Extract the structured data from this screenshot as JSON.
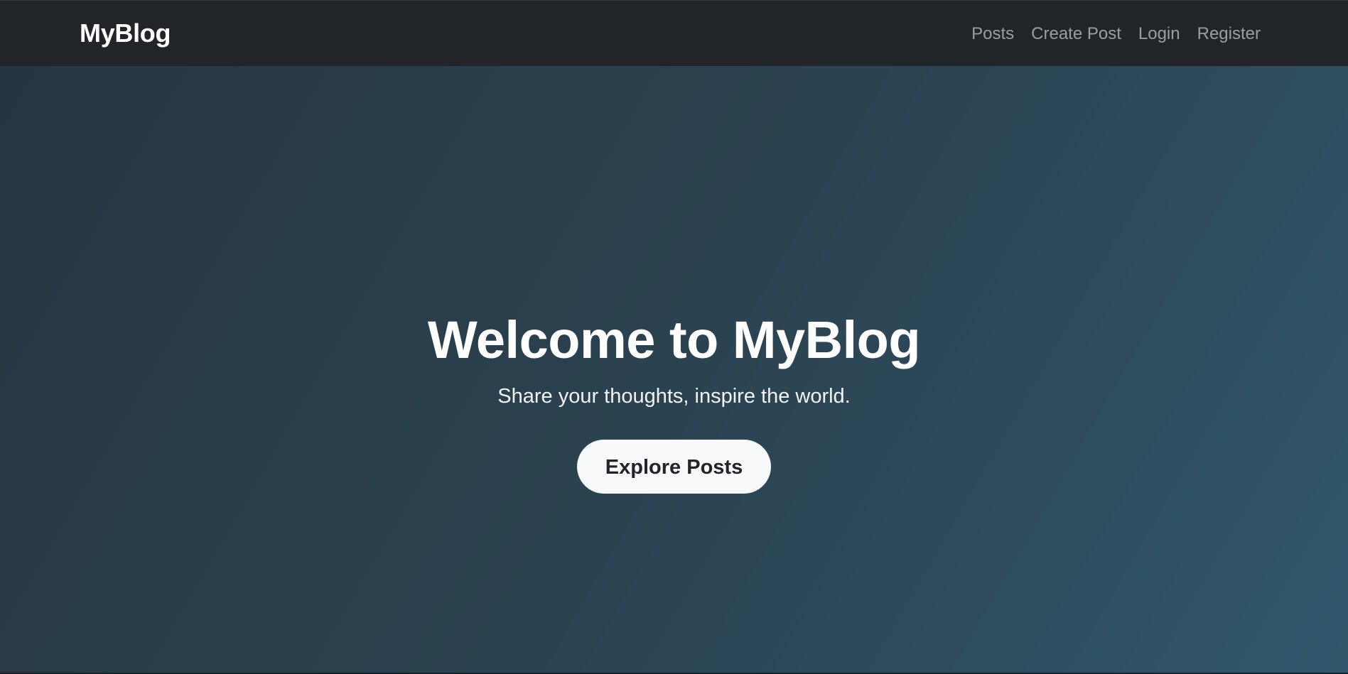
{
  "navbar": {
    "brand": "MyBlog",
    "links": [
      {
        "label": "Posts"
      },
      {
        "label": "Create Post"
      },
      {
        "label": "Login"
      },
      {
        "label": "Register"
      }
    ]
  },
  "hero": {
    "title": "Welcome to MyBlog",
    "subtitle": "Share your thoughts, inspire the world.",
    "button_label": "Explore Posts"
  },
  "colors": {
    "navbar_bg": "#212529",
    "hero_gradient_start": "#263640",
    "hero_gradient_end": "#30566b",
    "button_bg": "#f8f9fa"
  }
}
